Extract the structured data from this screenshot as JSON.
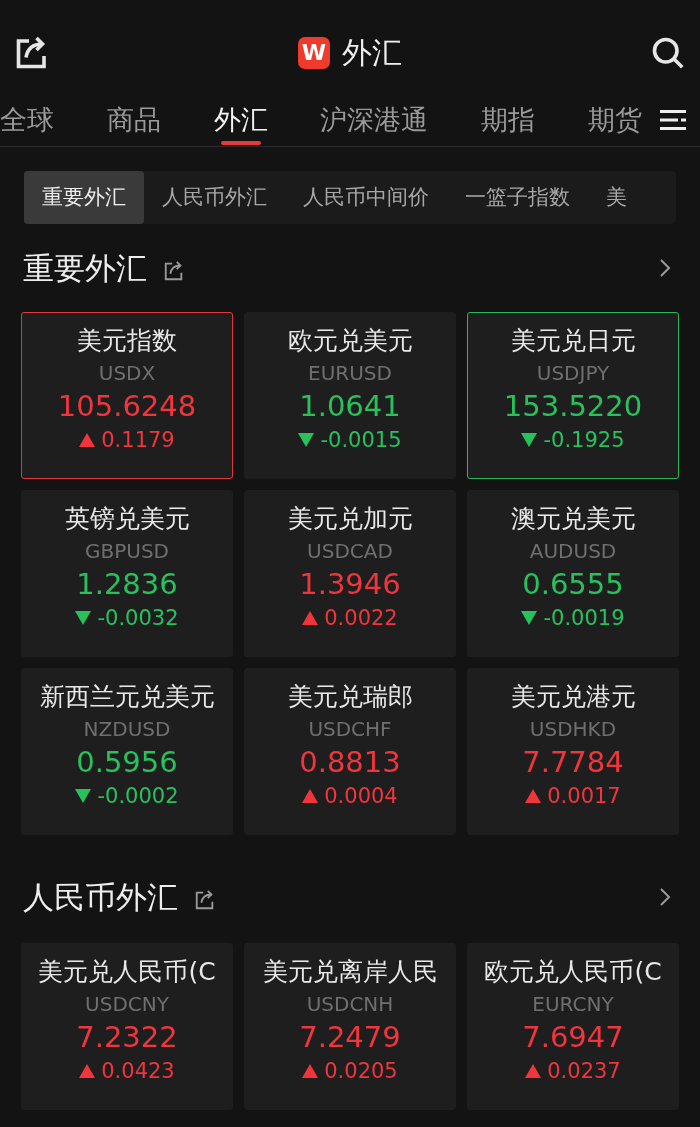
{
  "header": {
    "logo": "W",
    "title": "外汇"
  },
  "tabs": [
    {
      "label": "全球",
      "selected": false
    },
    {
      "label": "商品",
      "selected": false
    },
    {
      "label": "外汇",
      "selected": true
    },
    {
      "label": "沪深港通",
      "selected": false
    },
    {
      "label": "期指",
      "selected": false
    },
    {
      "label": "期货",
      "selected": false
    }
  ],
  "subtabs": [
    {
      "label": "重要外汇",
      "selected": true
    },
    {
      "label": "人民币外汇",
      "selected": false
    },
    {
      "label": "人民币中间价",
      "selected": false
    },
    {
      "label": "一篮子指数",
      "selected": false
    },
    {
      "label": "美",
      "selected": false
    }
  ],
  "sections": [
    {
      "title": "重要外汇",
      "cards": [
        {
          "name": "美元指数",
          "code": "USDX",
          "price": "105.6248",
          "change": "0.1179",
          "rising": true,
          "outlined": true
        },
        {
          "name": "欧元兑美元",
          "code": "EURUSD",
          "price": "1.0641",
          "change": "-0.0015",
          "rising": false,
          "outlined": false
        },
        {
          "name": "美元兑日元",
          "code": "USDJPY",
          "price": "153.5220",
          "change": "-0.1925",
          "rising": false,
          "outlined": true
        },
        {
          "name": "英镑兑美元",
          "code": "GBPUSD",
          "price": "1.2836",
          "change": "-0.0032",
          "rising": false,
          "outlined": false
        },
        {
          "name": "美元兑加元",
          "code": "USDCAD",
          "price": "1.3946",
          "change": "0.0022",
          "rising": true,
          "outlined": false
        },
        {
          "name": "澳元兑美元",
          "code": "AUDUSD",
          "price": "0.6555",
          "change": "-0.0019",
          "rising": false,
          "outlined": false
        },
        {
          "name": "新西兰元兑美元",
          "code": "NZDUSD",
          "price": "0.5956",
          "change": "-0.0002",
          "rising": false,
          "outlined": false
        },
        {
          "name": "美元兑瑞郎",
          "code": "USDCHF",
          "price": "0.8813",
          "change": "0.0004",
          "rising": true,
          "outlined": false
        },
        {
          "name": "美元兑港元",
          "code": "USDHKD",
          "price": "7.7784",
          "change": "0.0017",
          "rising": true,
          "outlined": false
        }
      ]
    },
    {
      "title": "人民币外汇",
      "cards": [
        {
          "name": "美元兑人民币(C",
          "code": "USDCNY",
          "price": "7.2322",
          "change": "0.0423",
          "rising": true,
          "outlined": false
        },
        {
          "name": "美元兑离岸人民",
          "code": "USDCNH",
          "price": "7.2479",
          "change": "0.0205",
          "rising": true,
          "outlined": false
        },
        {
          "name": "欧元兑人民币(C",
          "code": "EURCNY",
          "price": "7.6947",
          "change": "0.0237",
          "rising": true,
          "outlined": false
        }
      ]
    }
  ]
}
